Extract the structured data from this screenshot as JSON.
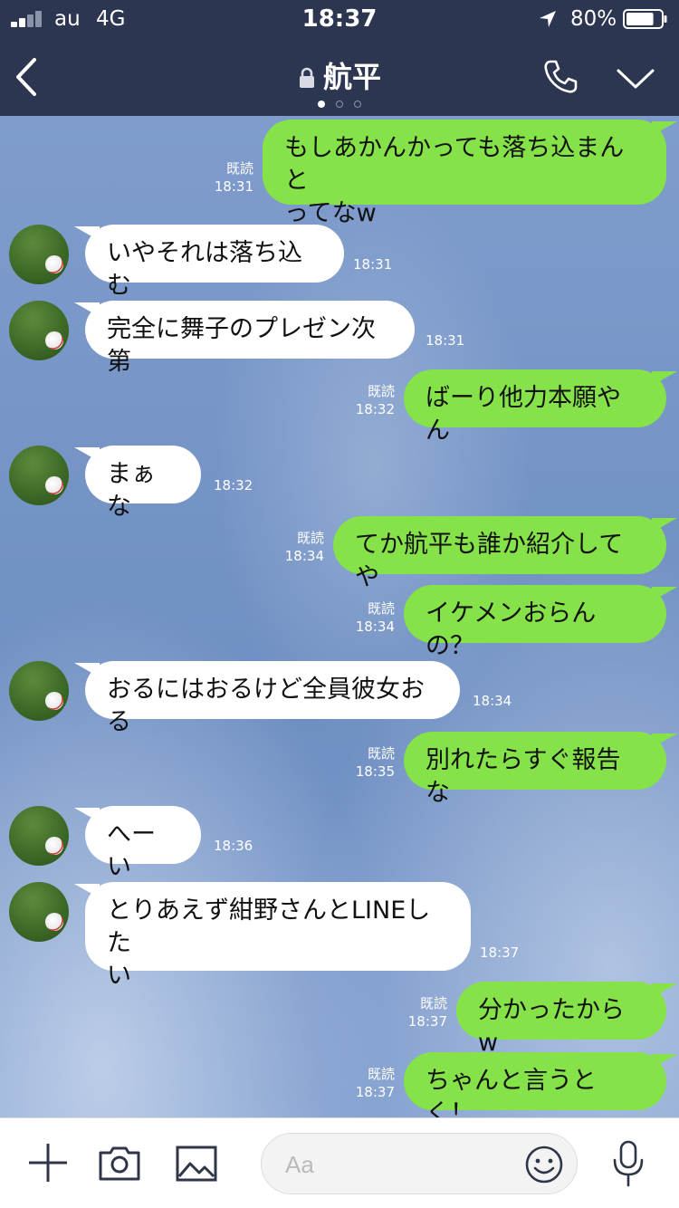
{
  "status_bar": {
    "carrier": "au",
    "network": "4G",
    "time": "18:37",
    "battery_percent": "80%",
    "battery_level": 0.8
  },
  "header": {
    "title": "航平",
    "page_dots": 3,
    "active_dot": 0
  },
  "messages": [
    {
      "side": "out",
      "lines": [
        "もしあかんかっても落ち込まんと",
        "ってなw"
      ],
      "read": "既読",
      "time": "18:31"
    },
    {
      "side": "in",
      "lines": [
        "いやそれは落ち込む"
      ],
      "time": "18:31"
    },
    {
      "side": "in",
      "lines": [
        "完全に舞子のプレゼン次第"
      ],
      "time": "18:31"
    },
    {
      "side": "out",
      "lines": [
        "ばーり他力本願やん"
      ],
      "read": "既読",
      "time": "18:32"
    },
    {
      "side": "in",
      "lines": [
        "まぁな"
      ],
      "time": "18:32"
    },
    {
      "side": "out",
      "lines": [
        "てか航平も誰か紹介してや"
      ],
      "read": "既読",
      "time": "18:34"
    },
    {
      "side": "out",
      "lines": [
        "イケメンおらんの？"
      ],
      "read": "既読",
      "time": "18:34"
    },
    {
      "side": "in",
      "lines": [
        "おるにはおるけど全員彼女おる"
      ],
      "time": "18:34"
    },
    {
      "side": "out",
      "lines": [
        "別れたらすぐ報告な"
      ],
      "read": "既読",
      "time": "18:35"
    },
    {
      "side": "in",
      "lines": [
        "へーい"
      ],
      "time": "18:36"
    },
    {
      "side": "in",
      "lines": [
        "とりあえず紺野さんとLINEした",
        "い"
      ],
      "time": "18:37"
    },
    {
      "side": "out",
      "lines": [
        "分かったからw"
      ],
      "read": "既読",
      "time": "18:37"
    },
    {
      "side": "out",
      "lines": [
        "ちゃんと言うとく！"
      ],
      "read": "既読",
      "time": "18:37"
    }
  ],
  "input": {
    "placeholder": "Aa"
  },
  "colors": {
    "header_bg": "#2c3650",
    "outgoing_bubble": "#85e249",
    "incoming_bubble": "#ffffff"
  },
  "icons": [
    "back-icon",
    "lock-icon",
    "phone-icon",
    "chevron-down-icon",
    "plus-icon",
    "camera-icon",
    "image-icon",
    "emoji-icon",
    "microphone-icon",
    "location-icon",
    "battery-icon",
    "signal-icon"
  ]
}
